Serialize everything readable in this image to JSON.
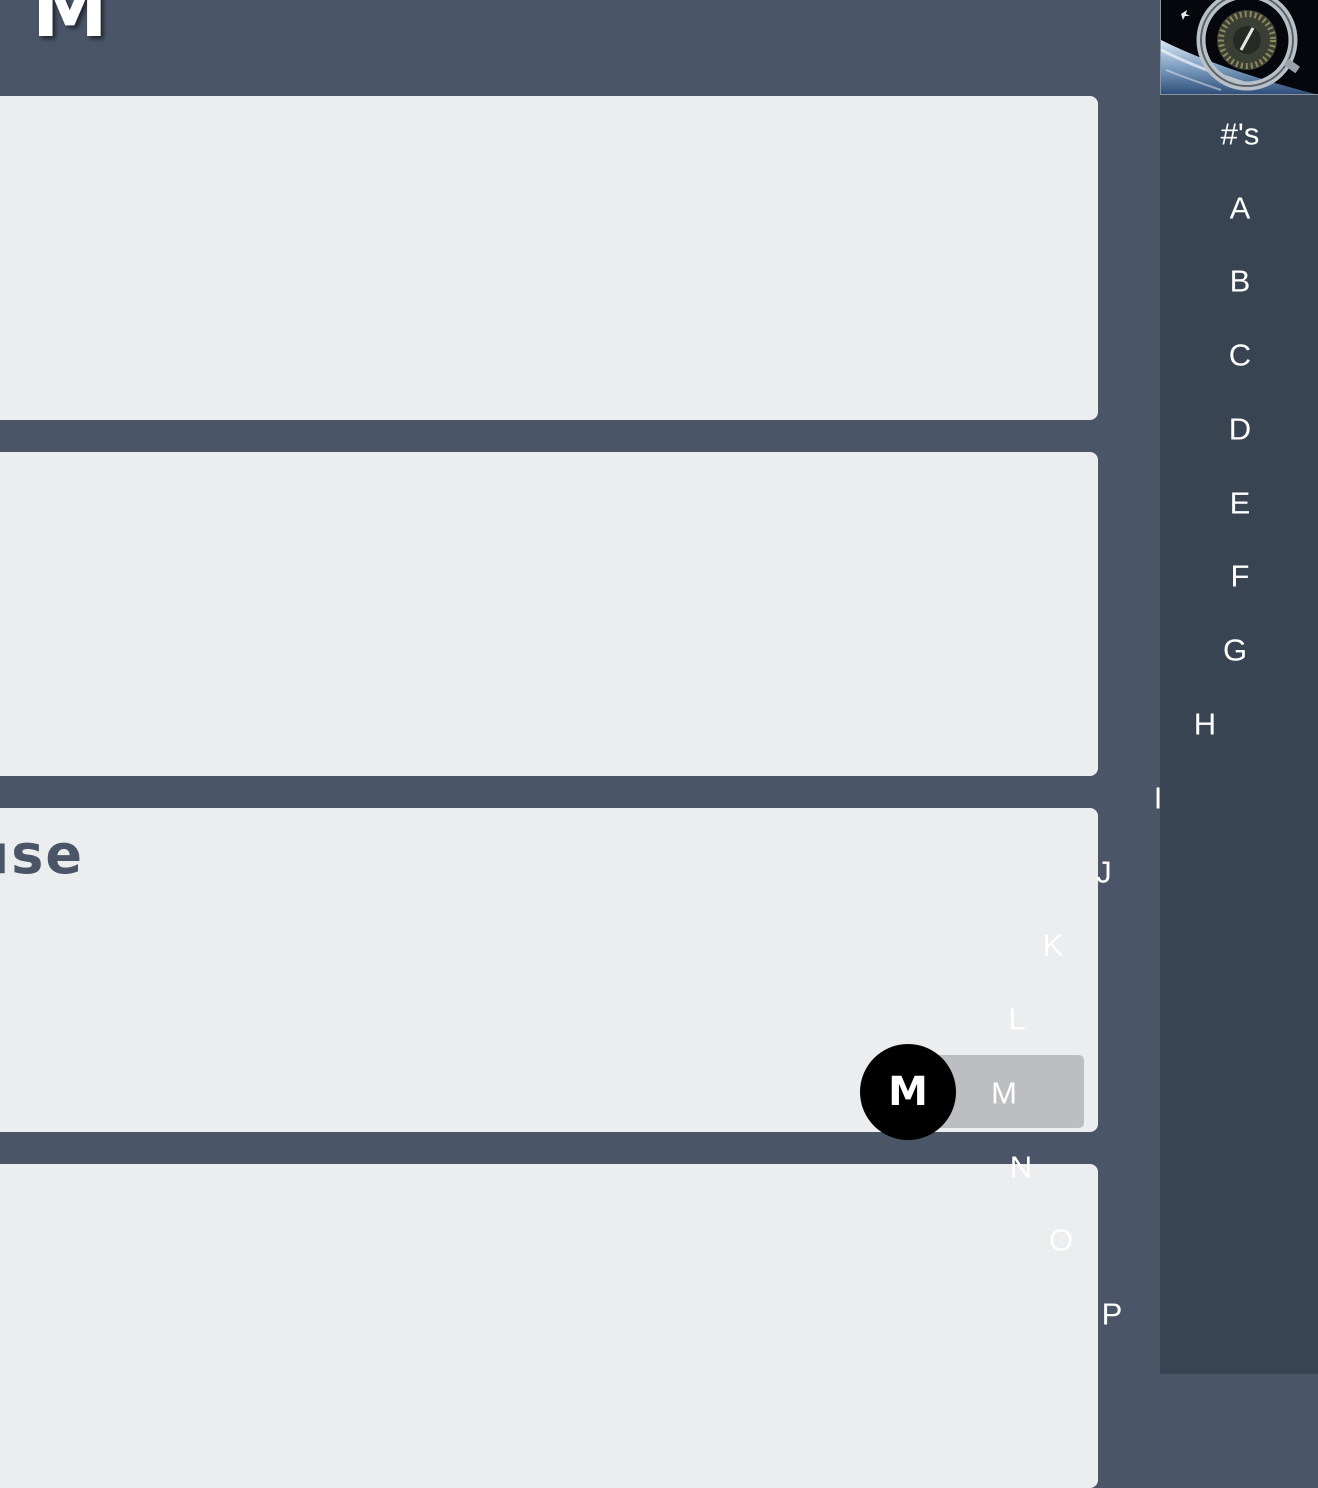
{
  "section": {
    "heading": "M"
  },
  "cards": [
    {
      "title": ""
    },
    {
      "title": ""
    },
    {
      "title": "use"
    },
    {
      "title": ""
    }
  ],
  "sidebar": {
    "thumbnail_alt": "space station orbiting earth",
    "index_letters": [
      "#'s",
      "A",
      "B",
      "C",
      "D",
      "E",
      "F",
      "G",
      "H",
      "I",
      "J",
      "K",
      "L",
      "M",
      "N",
      "O",
      "P"
    ],
    "active_letter": "M"
  },
  "indicator": {
    "letter": "M"
  },
  "colors": {
    "page_background": "#4a5568",
    "sidebar_background": "#394452",
    "card_background": "#ecedef",
    "card_title": "#4a5568",
    "active_pill": "#bdbec2",
    "indicator_bubble": "#000000"
  }
}
